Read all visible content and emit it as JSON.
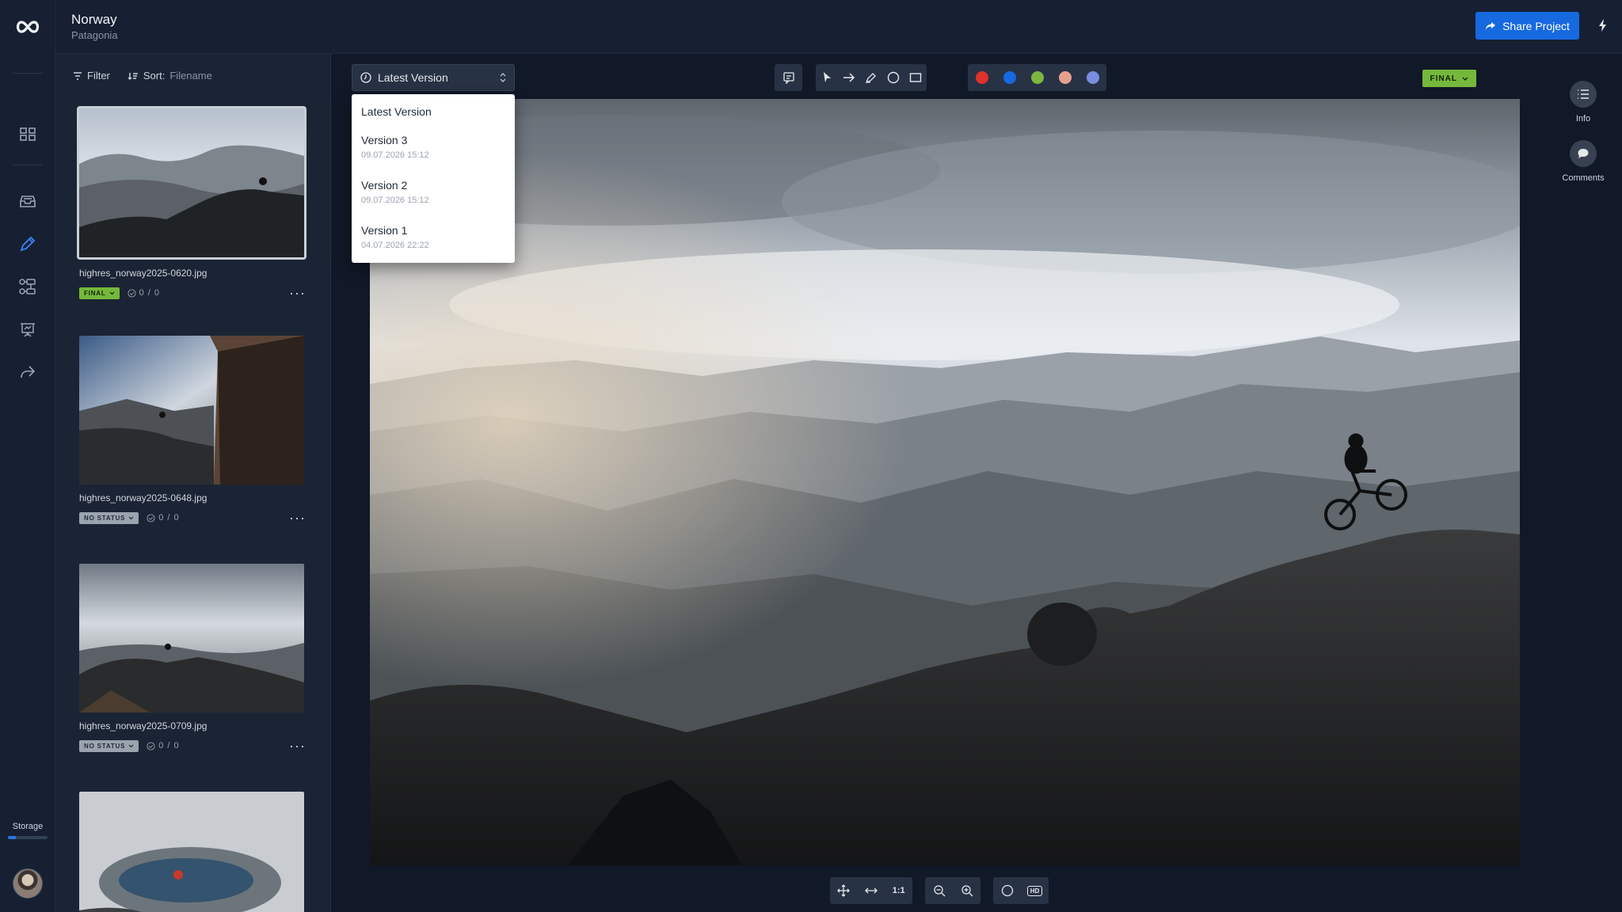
{
  "header": {
    "project_title": "Norway",
    "project_subtitle": "Patagonia",
    "share_label": "Share Project"
  },
  "rail": {
    "storage_label": "Storage",
    "storage_fraction": 0.2,
    "icons": [
      "logo-icon",
      "grid-icon",
      "inbox-icon",
      "pen-icon",
      "workflow-icon",
      "presentation-icon",
      "share-icon"
    ]
  },
  "filepanel": {
    "filter_label": "Filter",
    "sort_label": "Sort:",
    "sort_value": "Filename",
    "files": [
      {
        "name": "highres_norway2025-0620.jpg",
        "status": "FINAL",
        "comments": "0 / 0",
        "selected": true
      },
      {
        "name": "highres_norway2025-0648.jpg",
        "status": "NO STATUS",
        "comments": "0 / 0",
        "selected": false
      },
      {
        "name": "highres_norway2025-0709.jpg",
        "status": "NO STATUS",
        "comments": "0 / 0",
        "selected": false
      },
      {
        "name": "",
        "status": "",
        "comments": "",
        "selected": false
      }
    ]
  },
  "viewer": {
    "version_selected": "Latest Version",
    "versions": [
      {
        "name": "Latest Version",
        "date": ""
      },
      {
        "name": "Version 3",
        "date": "09.07.2026 15:12"
      },
      {
        "name": "Version 2",
        "date": "09.07.2026 15:12"
      },
      {
        "name": "Version 1",
        "date": "04.07.2026 22:22"
      }
    ],
    "status_badge": "FINAL",
    "colors": [
      "#e0322d",
      "#1769e0",
      "#7ab640",
      "#e8a08c",
      "#7a8ee0"
    ],
    "tools": [
      "comment-icon",
      "pointer-icon",
      "arrow-icon",
      "pen-icon",
      "circle-icon",
      "rectangle-icon"
    ],
    "zoom_one_to_one": "1:1",
    "hd_label": "HD"
  },
  "rightpanel": {
    "info_label": "Info",
    "comments_label": "Comments"
  }
}
